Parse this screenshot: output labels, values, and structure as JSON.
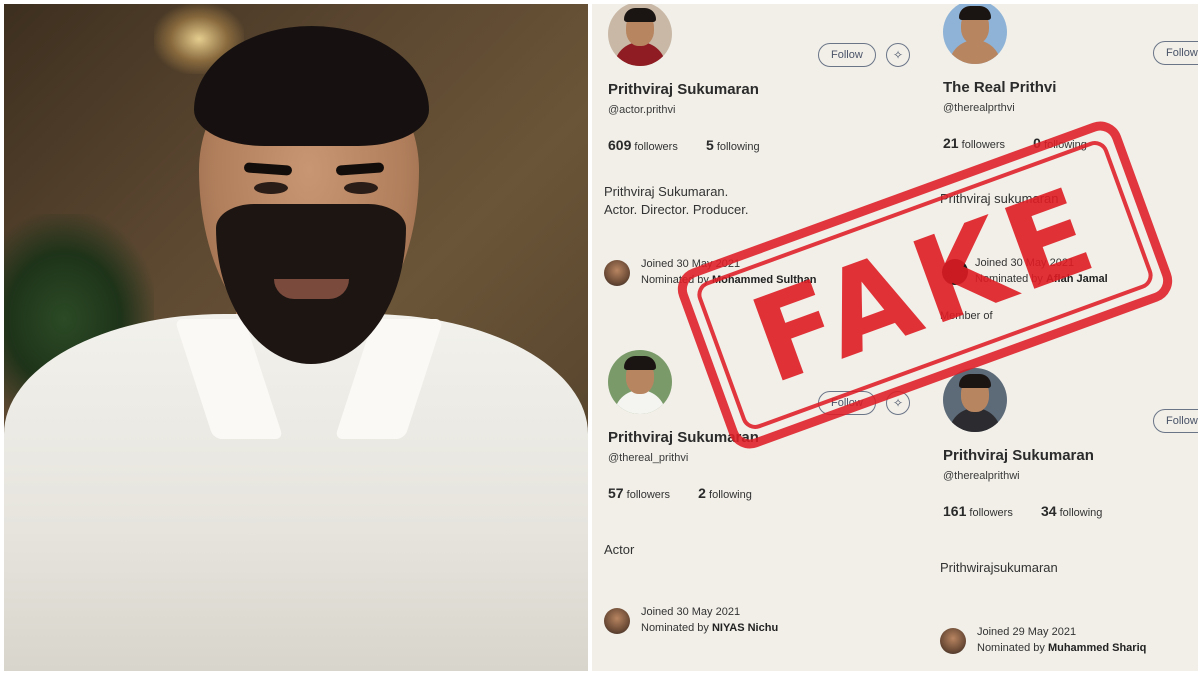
{
  "colors": {
    "stamp_red": "#de1c24",
    "panel_bg": "#f1efe8",
    "button_outline": "#6b7588"
  },
  "stamp": {
    "text": "FAKE"
  },
  "profiles": [
    {
      "name": "Prithviraj Sukumaran",
      "handle": "@actor.prithvi",
      "followers_count": "609",
      "followers_label": "followers",
      "following_count": "5",
      "following_label": "following",
      "bio_line1": "Prithviraj Sukumaran.",
      "bio_line2": "Actor. Director. Producer.",
      "joined": "Joined 30 May 2021",
      "nominated_prefix": "Nominated by",
      "nominated_by": "Mohammed Sulthan",
      "follow_label": "Follow"
    },
    {
      "name": "The Real Prithvi",
      "handle": "@therealprthvi",
      "followers_count": "21",
      "followers_label": "followers",
      "following_count": "0",
      "following_label": "following",
      "bio_line1": "Prithviraj sukumaran",
      "joined": "Joined 30 May 2021",
      "nominated_prefix": "Nominated by",
      "nominated_by": "Aflah Jamal",
      "member_of": "Member of",
      "follow_label": "Follow"
    },
    {
      "name": "Prithviraj  Sukumaran",
      "handle": "@thereal_prithvi",
      "followers_count": "57",
      "followers_label": "followers",
      "following_count": "2",
      "following_label": "following",
      "bio_line1": "Actor",
      "joined": "Joined 30 May 2021",
      "nominated_prefix": "Nominated by",
      "nominated_by": "NIYAS  Nichu",
      "follow_label": "Follow"
    },
    {
      "name": "Prithviraj Sukumaran",
      "handle": "@therealprithwi",
      "followers_count": "161",
      "followers_label": "followers",
      "following_count": "34",
      "following_label": "following",
      "bio_line1": "Prithwirajsukumaran",
      "joined": "Joined 29 May 2021",
      "nominated_prefix": "Nominated by",
      "nominated_by": "Muhammed Shariq",
      "follow_label": "Follow"
    }
  ]
}
